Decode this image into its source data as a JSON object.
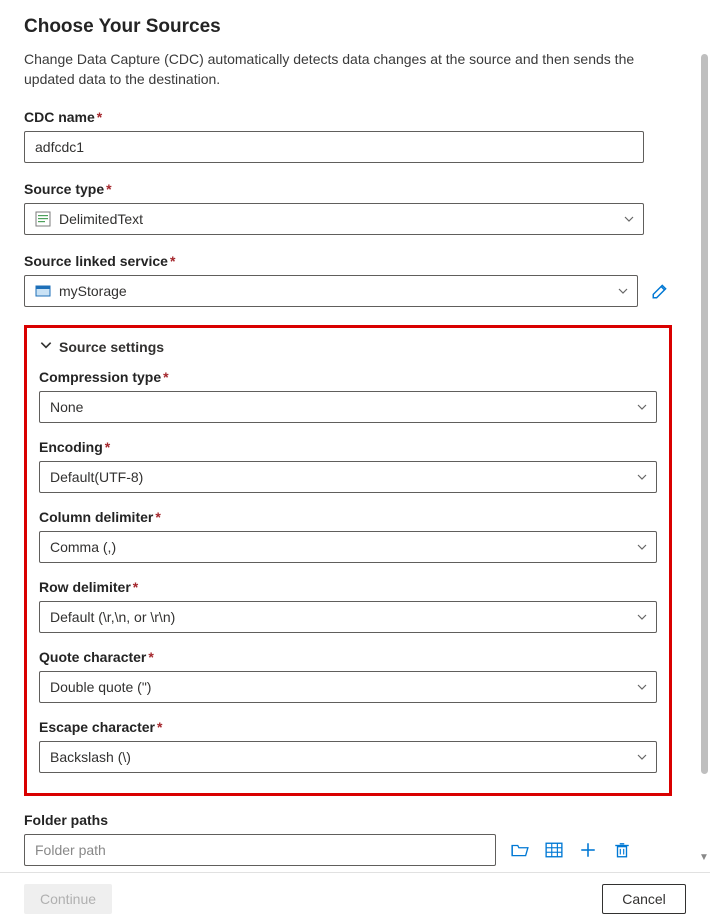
{
  "header": {
    "title": "Choose Your Sources",
    "description": "Change Data Capture (CDC) automatically detects data changes at the source and then sends the updated data to the destination."
  },
  "fields": {
    "cdc_name": {
      "label": "CDC name",
      "value": "adfcdc1",
      "required": true
    },
    "source_type": {
      "label": "Source type",
      "value": "DelimitedText",
      "required": true
    },
    "source_linked_service": {
      "label": "Source linked service",
      "value": "myStorage",
      "required": true
    }
  },
  "source_settings": {
    "section_label": "Source settings",
    "compression_type": {
      "label": "Compression type",
      "value": "None",
      "required": true
    },
    "encoding": {
      "label": "Encoding",
      "value": "Default(UTF-8)",
      "required": true
    },
    "column_delimiter": {
      "label": "Column delimiter",
      "value": "Comma (,)",
      "required": true
    },
    "row_delimiter": {
      "label": "Row delimiter",
      "value": "Default (\\r,\\n, or \\r\\n)",
      "required": true
    },
    "quote_character": {
      "label": "Quote character",
      "value": "Double quote (\")",
      "required": true
    },
    "escape_character": {
      "label": "Escape character",
      "value": "Backslash (\\)",
      "required": true
    }
  },
  "folder_paths": {
    "label": "Folder paths",
    "placeholder": "Folder path"
  },
  "footer": {
    "continue_label": "Continue",
    "cancel_label": "Cancel"
  },
  "icons": {
    "delimited_text": "delimited-text-icon",
    "storage": "storage-icon",
    "edit": "pencil-icon",
    "browse": "folder-open-icon",
    "preview": "table-preview-icon",
    "add": "plus-icon",
    "delete": "trash-icon",
    "chevron_down": "chevron-down-icon"
  }
}
